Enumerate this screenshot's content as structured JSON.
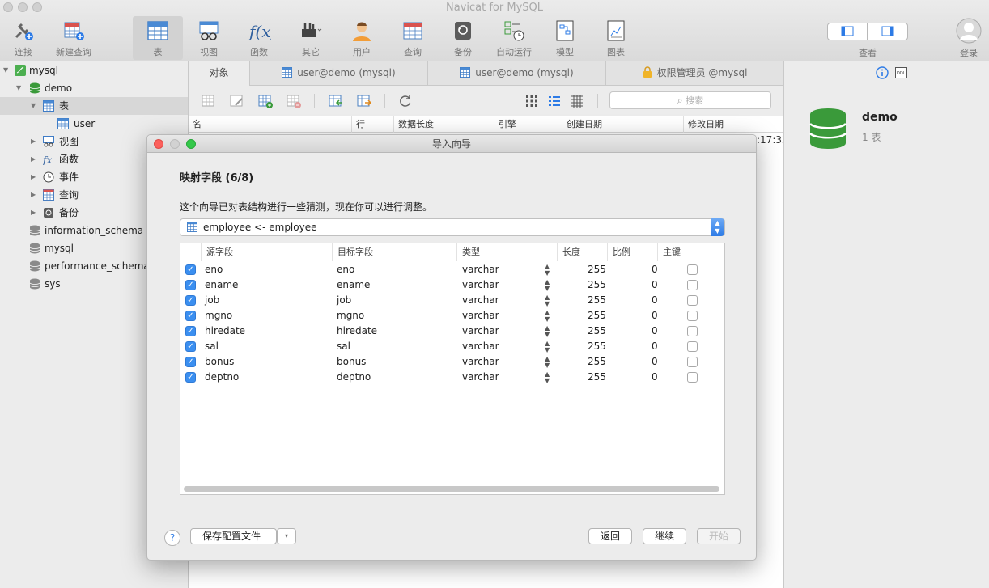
{
  "app": {
    "title": "Navicat for MySQL"
  },
  "toolbar": [
    {
      "label": "连接",
      "icon": "plug-icon"
    },
    {
      "label": "新建查询",
      "icon": "new-query-icon"
    },
    {
      "label": "表",
      "icon": "table-icon"
    },
    {
      "label": "视图",
      "icon": "view-icon"
    },
    {
      "label": "函数",
      "icon": "function-icon"
    },
    {
      "label": "其它",
      "icon": "tools-icon"
    },
    {
      "label": "用户",
      "icon": "user-icon"
    },
    {
      "label": "查询",
      "icon": "query-icon"
    },
    {
      "label": "备份",
      "icon": "backup-icon"
    },
    {
      "label": "自动运行",
      "icon": "automation-icon"
    },
    {
      "label": "模型",
      "icon": "model-icon"
    },
    {
      "label": "图表",
      "icon": "chart-icon"
    }
  ],
  "toolbar_right": {
    "view_label": "查看",
    "login_label": "登录"
  },
  "sidebar": {
    "items": [
      {
        "label": "mysql"
      },
      {
        "label": "demo"
      },
      {
        "label": "表"
      },
      {
        "label": "user"
      },
      {
        "label": "视图"
      },
      {
        "label": "函数"
      },
      {
        "label": "事件"
      },
      {
        "label": "查询"
      },
      {
        "label": "备份"
      },
      {
        "label": "information_schema"
      },
      {
        "label": "mysql"
      },
      {
        "label": "performance_schema"
      },
      {
        "label": "sys"
      }
    ]
  },
  "tabs": [
    {
      "label": "对象"
    },
    {
      "label": "user@demo (mysql)"
    },
    {
      "label": "user@demo (mysql)"
    },
    {
      "label": "权限管理员 @mysql"
    }
  ],
  "search": {
    "placeholder": "搜索"
  },
  "object_columns": [
    "名",
    "行",
    "数据长度",
    "引擎",
    "创建日期",
    "修改日期"
  ],
  "time_fragment": ":17:32",
  "info": {
    "db_name": "demo",
    "db_meta": "1 表"
  },
  "dialog": {
    "title": "导入向导",
    "step": "映射字段 (6/8)",
    "description": "这个向导已对表结构进行一些猜测，现在你可以进行调整。",
    "table_select": "employee <- employee",
    "columns": [
      "源字段",
      "目标字段",
      "类型",
      "长度",
      "比例",
      "主键"
    ],
    "rows": [
      {
        "source": "eno",
        "target": "eno",
        "type": "varchar",
        "length": "255",
        "scale": "0"
      },
      {
        "source": "ename",
        "target": "ename",
        "type": "varchar",
        "length": "255",
        "scale": "0"
      },
      {
        "source": "job",
        "target": "job",
        "type": "varchar",
        "length": "255",
        "scale": "0"
      },
      {
        "source": "mgno",
        "target": "mgno",
        "type": "varchar",
        "length": "255",
        "scale": "0"
      },
      {
        "source": "hiredate",
        "target": "hiredate",
        "type": "varchar",
        "length": "255",
        "scale": "0"
      },
      {
        "source": "sal",
        "target": "sal",
        "type": "varchar",
        "length": "255",
        "scale": "0"
      },
      {
        "source": "bonus",
        "target": "bonus",
        "type": "varchar",
        "length": "255",
        "scale": "0"
      },
      {
        "source": "deptno",
        "target": "deptno",
        "type": "varchar",
        "length": "255",
        "scale": "0"
      }
    ],
    "buttons": {
      "help": "?",
      "save_config": "保存配置文件",
      "back": "返回",
      "continue": "继续",
      "start": "开始"
    }
  }
}
